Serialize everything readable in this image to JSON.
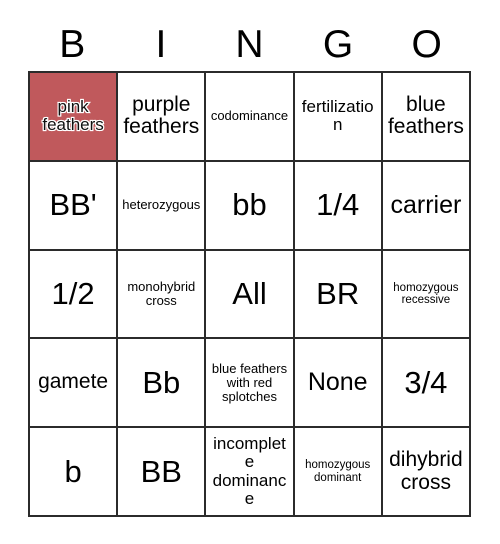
{
  "card": {
    "title": "BINGO",
    "header_letters": [
      "B",
      "I",
      "N",
      "G",
      "O"
    ],
    "marked_color": "#c0595c",
    "border_color": "#2b2b2b",
    "background_color": "#ffffff",
    "text_color": "#000000",
    "rows": 5,
    "columns": 5,
    "cells": [
      {
        "text": "pink feathers",
        "marked": true,
        "size": "sm"
      },
      {
        "text": "purple feathers",
        "marked": false,
        "size": "md"
      },
      {
        "text": "codominance",
        "marked": false,
        "size": "xs"
      },
      {
        "text": "fertilization",
        "marked": false,
        "size": "sm"
      },
      {
        "text": "blue feathers",
        "marked": false,
        "size": "md"
      },
      {
        "text": "BB'",
        "marked": false,
        "size": "xl"
      },
      {
        "text": "heterozygous",
        "marked": false,
        "size": "xs"
      },
      {
        "text": "bb",
        "marked": false,
        "size": "xl"
      },
      {
        "text": "1/4",
        "marked": false,
        "size": "xl"
      },
      {
        "text": "carrier",
        "marked": false,
        "size": "lg"
      },
      {
        "text": "1/2",
        "marked": false,
        "size": "xl"
      },
      {
        "text": "monohybrid cross",
        "marked": false,
        "size": "xs"
      },
      {
        "text": "All",
        "marked": false,
        "size": "xl"
      },
      {
        "text": "BR",
        "marked": false,
        "size": "xl"
      },
      {
        "text": "homozygous recessive",
        "marked": false,
        "size": "xxs"
      },
      {
        "text": "gamete",
        "marked": false,
        "size": "md"
      },
      {
        "text": "Bb",
        "marked": false,
        "size": "xl"
      },
      {
        "text": "blue feathers with red splotches",
        "marked": false,
        "size": "xs"
      },
      {
        "text": "None",
        "marked": false,
        "size": "lg"
      },
      {
        "text": "3/4",
        "marked": false,
        "size": "xl"
      },
      {
        "text": "b",
        "marked": false,
        "size": "xl"
      },
      {
        "text": "BB",
        "marked": false,
        "size": "xl"
      },
      {
        "text": "incomplete dominance",
        "marked": false,
        "size": "sm"
      },
      {
        "text": "homozygous dominant",
        "marked": false,
        "size": "xxs"
      },
      {
        "text": "dihybrid cross",
        "marked": false,
        "size": "md"
      }
    ]
  }
}
